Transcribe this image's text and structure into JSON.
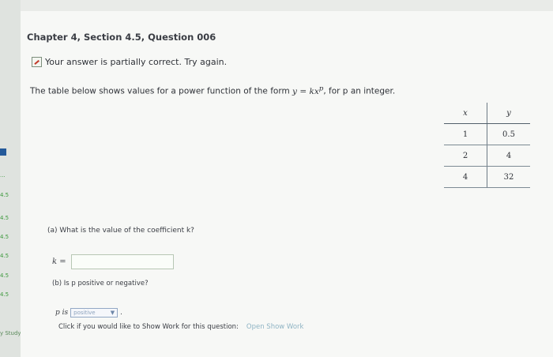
{
  "sidebar": {
    "items": [
      "4.5",
      "4.5",
      "4.5",
      "4.5",
      "4.5",
      "4.5"
    ],
    "bottom": "y Study"
  },
  "header": {
    "title": "Chapter 4, Section 4.5, Question 006"
  },
  "feedback": {
    "text": "Your answer is partially correct. Try again."
  },
  "question": {
    "intro_prefix": "The table below shows values for a power function of the form",
    "formula": "y = kx",
    "formula_sup": "p",
    "intro_suffix": ", for p an integer."
  },
  "table": {
    "headers": [
      "x",
      "y"
    ],
    "rows": [
      [
        "1",
        "0.5"
      ],
      [
        "2",
        "4"
      ],
      [
        "4",
        "32"
      ]
    ]
  },
  "part_a": {
    "label": "(a) What is the value of the coefficient k?",
    "var": "k =",
    "value": ""
  },
  "part_b": {
    "label": "(b) Is p positive or negative?",
    "prefix": "p is",
    "select_value": "positive"
  },
  "show_work": {
    "text": "Click if you would like to Show Work for this question:",
    "link": "Open Show Work"
  }
}
